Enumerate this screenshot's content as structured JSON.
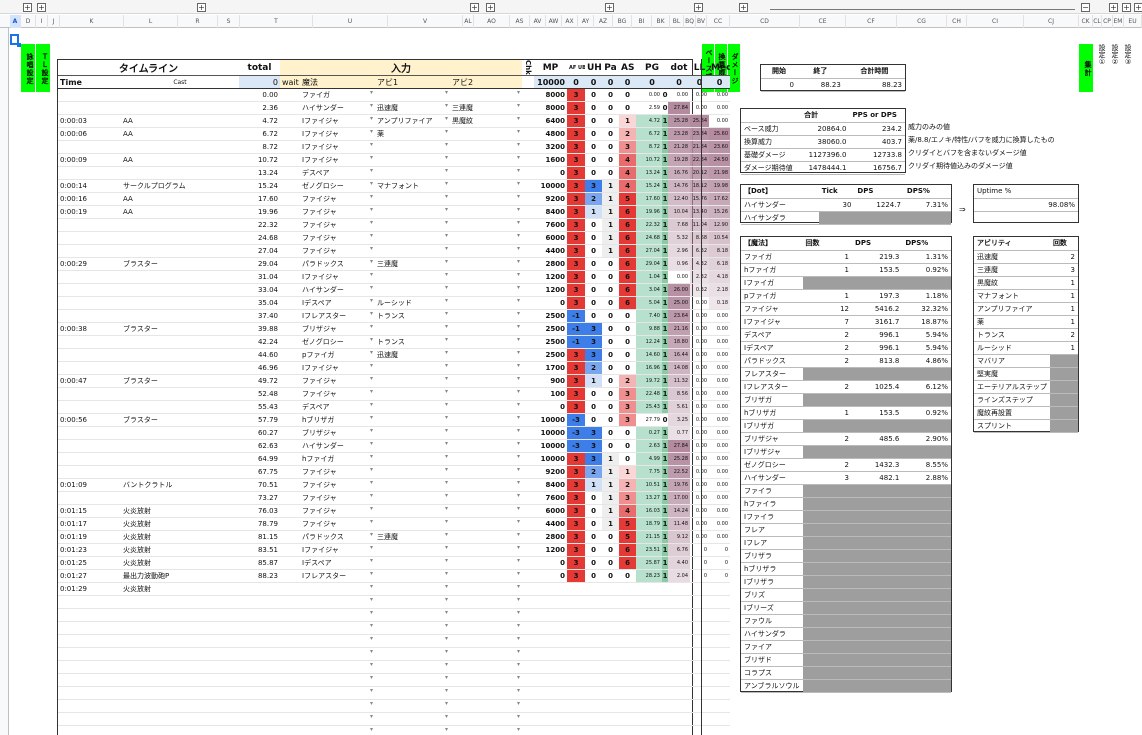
{
  "col_headers": [
    "A",
    "D",
    "I",
    "J",
    "K",
    "L",
    "R",
    "S",
    "T",
    "U",
    "V",
    "AL",
    "AO",
    "AS",
    "AV",
    "AW",
    "AX",
    "AY",
    "AZ",
    "BG",
    "BI",
    "BK",
    "BL",
    "BQ",
    "BV",
    "CC",
    "CD",
    "CE",
    "CF",
    "CG",
    "CH",
    "CI",
    "CJ",
    "CK",
    "CL",
    "CP",
    "EM",
    "EU"
  ],
  "side_labels": {
    "sozai": "詠唱設定",
    "tl": "ＴＬ設定",
    "base": "ベース威力",
    "kaisan": "換算威力",
    "dmg": "ダメージ",
    "shukei": "集計",
    "s1": "設定①",
    "s2": "設定②",
    "s3": "設定③"
  },
  "header": {
    "timeline": "タイムライン",
    "total": "total",
    "input": "入力",
    "chk": "Chk",
    "mp": "MP",
    "ahoo": "AF UB",
    "uh": "UH",
    "pa": "Pa",
    "as": "AS",
    "pg": "PG",
    "dot": "dot",
    "ll": "LL",
    "med": "Med",
    "time": "Time",
    "cast": "Cast",
    "total_val": "0",
    "wait": "wait",
    "skill": "魔法",
    "abi1": "アビ1",
    "abi2": "アビ2",
    "mp_val": "10000",
    "zeros": [
      "0",
      "0",
      "0",
      "0",
      "0",
      "0",
      "0",
      "0"
    ]
  },
  "rows": [
    {
      "t": "",
      "n": "",
      "tot": "0.00",
      "sk": "ファイガ",
      "a1": "",
      "a2": "",
      "mp": "8000",
      "af": "3",
      "uh": "0",
      "pa": "0",
      "as": "0",
      "pg": "0.00",
      "pgv": "0",
      "d": "0.00",
      "ll": "0.00",
      "md": "0.00"
    },
    {
      "t": "",
      "n": "",
      "tot": "2.36",
      "sk": "ハイサンダー",
      "a1": "迅速魔",
      "a2": "三連魔",
      "mp": "8000",
      "af": "3",
      "uh": "0",
      "pa": "0",
      "as": "0",
      "pg": "2.59",
      "pgv": "0",
      "d": "27.84",
      "ll": "0.00",
      "md": "0.00"
    },
    {
      "t": "0:00:03",
      "n": "AA",
      "tot": "4.72",
      "sk": "Iファイジャ",
      "a1": "アンプリファイア",
      "a2": "黒魔紋",
      "mp": "6400",
      "af": "3",
      "uh": "0",
      "pa": "0",
      "as": "1",
      "pg": "4.72",
      "pgv": "1",
      "d": "25.28",
      "ll": "25.84",
      "md": "0.00"
    },
    {
      "t": "0:00:06",
      "n": "AA",
      "tot": "6.72",
      "sk": "Iファイジャ",
      "a1": "薬",
      "a2": "",
      "mp": "4800",
      "af": "3",
      "uh": "0",
      "pa": "0",
      "as": "2",
      "pg": "6.72",
      "pgv": "1",
      "d": "23.28",
      "ll": "23.84",
      "md": "25.60"
    },
    {
      "t": "",
      "n": "",
      "tot": "8.72",
      "sk": "Iファイジャ",
      "a1": "",
      "a2": "",
      "mp": "3200",
      "af": "3",
      "uh": "0",
      "pa": "0",
      "as": "3",
      "pg": "8.72",
      "pgv": "1",
      "d": "21.28",
      "ll": "21.84",
      "md": "23.60"
    },
    {
      "t": "0:00:09",
      "n": "AA",
      "tot": "10.72",
      "sk": "Iファイジャ",
      "a1": "",
      "a2": "",
      "mp": "1600",
      "af": "3",
      "uh": "0",
      "pa": "0",
      "as": "4",
      "pg": "10.72",
      "pgv": "1",
      "d": "19.28",
      "ll": "22.84",
      "md": "24.50"
    },
    {
      "t": "",
      "n": "",
      "tot": "13.24",
      "sk": "デスペア",
      "a1": "",
      "a2": "",
      "mp": "0",
      "af": "3",
      "uh": "0",
      "pa": "0",
      "as": "4",
      "pg": "13.24",
      "pgv": "1",
      "d": "16.76",
      "ll": "20.12",
      "md": "21.98"
    },
    {
      "t": "0:00:14",
      "n": "サークルプログラム",
      "tot": "15.24",
      "sk": "ゼノグロシー",
      "a1": "マナフォント",
      "a2": "",
      "mp": "10000",
      "af": "3",
      "uh": "3",
      "pa": "1",
      "as": "4",
      "pg": "15.24",
      "pgv": "1",
      "d": "14.76",
      "ll": "18.12",
      "md": "19.98"
    },
    {
      "t": "0:00:16",
      "n": "AA",
      "tot": "17.60",
      "sk": "ファイジャ",
      "a1": "",
      "a2": "",
      "mp": "9200",
      "af": "3",
      "uh": "2",
      "pa": "1",
      "as": "5",
      "pg": "17.60",
      "pgv": "1",
      "d": "12.40",
      "ll": "15.76",
      "md": "17.62"
    },
    {
      "t": "0:00:19",
      "n": "AA",
      "tot": "19.96",
      "sk": "ファイジャ",
      "a1": "",
      "a2": "",
      "mp": "8400",
      "af": "3",
      "uh": "1",
      "pa": "1",
      "as": "6",
      "pg": "19.96",
      "pgv": "1",
      "d": "10.04",
      "ll": "13.40",
      "md": "15.26"
    },
    {
      "t": "",
      "n": "",
      "tot": "22.32",
      "sk": "ファイジャ",
      "a1": "",
      "a2": "",
      "mp": "7600",
      "af": "3",
      "uh": "0",
      "pa": "1",
      "as": "6",
      "pg": "22.32",
      "pgv": "1",
      "d": "7.68",
      "ll": "11.04",
      "md": "12.90"
    },
    {
      "t": "",
      "n": "",
      "tot": "24.68",
      "sk": "ファイジャ",
      "a1": "",
      "a2": "",
      "mp": "6000",
      "af": "3",
      "uh": "0",
      "pa": "1",
      "as": "6",
      "pg": "24.68",
      "pgv": "1",
      "d": "5.32",
      "ll": "8.68",
      "md": "10.54"
    },
    {
      "t": "",
      "n": "",
      "tot": "27.04",
      "sk": "ファイジャ",
      "a1": "",
      "a2": "",
      "mp": "4400",
      "af": "3",
      "uh": "0",
      "pa": "1",
      "as": "6",
      "pg": "27.04",
      "pgv": "1",
      "d": "2.96",
      "ll": "6.32",
      "md": "8.18"
    },
    {
      "t": "0:00:29",
      "n": "ブラスター",
      "tot": "29.04",
      "sk": "パラドックス",
      "a1": "三連魔",
      "a2": "",
      "mp": "2800",
      "af": "3",
      "uh": "0",
      "pa": "0",
      "as": "6",
      "pg": "29.04",
      "pgv": "1",
      "d": "0.96",
      "ll": "4.32",
      "md": "6.18"
    },
    {
      "t": "",
      "n": "",
      "tot": "31.04",
      "sk": "Iファイジャ",
      "a1": "",
      "a2": "",
      "mp": "1200",
      "af": "3",
      "uh": "0",
      "pa": "0",
      "as": "6",
      "pg": "1.04",
      "pgv": "1",
      "d": "0.00",
      "ll": "2.32",
      "md": "4.18"
    },
    {
      "t": "",
      "n": "",
      "tot": "33.04",
      "sk": "ハイサンダー",
      "a1": "",
      "a2": "",
      "mp": "1200",
      "af": "3",
      "uh": "0",
      "pa": "0",
      "as": "6",
      "pg": "3.04",
      "pgv": "1",
      "d": "26.00",
      "ll": "0.32",
      "md": "2.18"
    },
    {
      "t": "",
      "n": "",
      "tot": "35.04",
      "sk": "Iデスペア",
      "a1": "ルーシッド",
      "a2": "",
      "mp": "0",
      "af": "3",
      "uh": "0",
      "pa": "0",
      "as": "6",
      "pg": "5.04",
      "pgv": "1",
      "d": "25.00",
      "ll": "0.00",
      "md": "0.18"
    },
    {
      "t": "",
      "n": "",
      "tot": "37.40",
      "sk": "Iフレアスター",
      "a1": "トランス",
      "a2": "",
      "mp": "2500",
      "af": "-1",
      "uh": "0",
      "pa": "0",
      "as": "0",
      "pg": "7.40",
      "pgv": "1",
      "d": "23.64",
      "ll": "0.00",
      "md": "0.00"
    },
    {
      "t": "0:00:38",
      "n": "ブラスター",
      "tot": "39.88",
      "sk": "ブリザジャ",
      "a1": "",
      "a2": "",
      "mp": "2500",
      "af": "-1",
      "uh": "3",
      "pa": "0",
      "as": "0",
      "pg": "9.88",
      "pgv": "1",
      "d": "21.16",
      "ll": "0.00",
      "md": "0.00"
    },
    {
      "t": "",
      "n": "",
      "tot": "42.24",
      "sk": "ゼノグロシー",
      "a1": "トランス",
      "a2": "",
      "mp": "2500",
      "af": "-1",
      "uh": "3",
      "pa": "0",
      "as": "0",
      "pg": "12.24",
      "pgv": "1",
      "d": "18.80",
      "ll": "0.00",
      "md": "0.00"
    },
    {
      "t": "",
      "n": "",
      "tot": "44.60",
      "sk": "pファイガ",
      "a1": "迅速魔",
      "a2": "",
      "mp": "2500",
      "af": "3",
      "uh": "3",
      "pa": "0",
      "as": "0",
      "pg": "14.60",
      "pgv": "1",
      "d": "16.44",
      "ll": "0.00",
      "md": "0.00"
    },
    {
      "t": "",
      "n": "",
      "tot": "46.96",
      "sk": "Iファイジャ",
      "a1": "",
      "a2": "",
      "mp": "1700",
      "af": "3",
      "uh": "2",
      "pa": "0",
      "as": "0",
      "pg": "16.96",
      "pgv": "1",
      "d": "14.08",
      "ll": "0.00",
      "md": "0.00"
    },
    {
      "t": "0:00:47",
      "n": "ブラスター",
      "tot": "49.72",
      "sk": "ファイジャ",
      "a1": "",
      "a2": "",
      "mp": "900",
      "af": "3",
      "uh": "1",
      "pa": "0",
      "as": "2",
      "pg": "19.72",
      "pgv": "1",
      "d": "11.32",
      "ll": "0.00",
      "md": "0.00"
    },
    {
      "t": "",
      "n": "",
      "tot": "52.48",
      "sk": "ファイジャ",
      "a1": "",
      "a2": "",
      "mp": "100",
      "af": "3",
      "uh": "0",
      "pa": "0",
      "as": "3",
      "pg": "22.48",
      "pgv": "1",
      "d": "8.56",
      "ll": "0.00",
      "md": "0.00"
    },
    {
      "t": "",
      "n": "",
      "tot": "55.43",
      "sk": "デスペア",
      "a1": "",
      "a2": "",
      "mp": "0",
      "af": "3",
      "uh": "0",
      "pa": "0",
      "as": "3",
      "pg": "25.43",
      "pgv": "1",
      "d": "5.61",
      "ll": "0.00",
      "md": "0.00"
    },
    {
      "t": "0:00:56",
      "n": "ブラスター",
      "tot": "57.79",
      "sk": "hブリザガ",
      "a1": "",
      "a2": "",
      "mp": "10000",
      "af": "-3",
      "uh": "0",
      "pa": "0",
      "as": "3",
      "pg": "27.79",
      "pgv": "0",
      "d": "3.25",
      "ll": "0.00",
      "md": "0.00"
    },
    {
      "t": "",
      "n": "",
      "tot": "60.27",
      "sk": "ブリザジャ",
      "a1": "",
      "a2": "",
      "mp": "10000",
      "af": "-3",
      "uh": "3",
      "pa": "0",
      "as": "0",
      "pg": "0.27",
      "pgv": "1",
      "d": "0.77",
      "ll": "0.00",
      "md": "0.00"
    },
    {
      "t": "",
      "n": "",
      "tot": "62.63",
      "sk": "ハイサンダー",
      "a1": "",
      "a2": "",
      "mp": "10000",
      "af": "-3",
      "uh": "3",
      "pa": "0",
      "as": "0",
      "pg": "2.63",
      "pgv": "1",
      "d": "27.84",
      "ll": "0.00",
      "md": "0.00"
    },
    {
      "t": "",
      "n": "",
      "tot": "64.99",
      "sk": "hファイガ",
      "a1": "",
      "a2": "",
      "mp": "10000",
      "af": "3",
      "uh": "3",
      "pa": "1",
      "as": "0",
      "pg": "4.99",
      "pgv": "1",
      "d": "25.28",
      "ll": "0.00",
      "md": "0.00"
    },
    {
      "t": "",
      "n": "",
      "tot": "67.75",
      "sk": "ファイジャ",
      "a1": "",
      "a2": "",
      "mp": "9200",
      "af": "3",
      "uh": "2",
      "pa": "1",
      "as": "1",
      "pg": "7.75",
      "pgv": "1",
      "d": "22.52",
      "ll": "0.00",
      "md": "0.00"
    },
    {
      "t": "0:01:09",
      "n": "バントクラトル",
      "tot": "70.51",
      "sk": "ファイジャ",
      "a1": "",
      "a2": "",
      "mp": "8400",
      "af": "3",
      "uh": "1",
      "pa": "1",
      "as": "2",
      "pg": "10.51",
      "pgv": "1",
      "d": "19.76",
      "ll": "0.00",
      "md": "0.00"
    },
    {
      "t": "",
      "n": "",
      "tot": "73.27",
      "sk": "ファイジャ",
      "a1": "",
      "a2": "",
      "mp": "7600",
      "af": "3",
      "uh": "0",
      "pa": "1",
      "as": "3",
      "pg": "13.27",
      "pgv": "1",
      "d": "17.00",
      "ll": "0.00",
      "md": "0.00"
    },
    {
      "t": "0:01:15",
      "n": "火炎放射",
      "tot": "76.03",
      "sk": "ファイジャ",
      "a1": "",
      "a2": "",
      "mp": "6000",
      "af": "3",
      "uh": "0",
      "pa": "1",
      "as": "4",
      "pg": "16.03",
      "pgv": "1",
      "d": "14.24",
      "ll": "0.00",
      "md": "0.00"
    },
    {
      "t": "0:01:17",
      "n": "火炎放射",
      "tot": "78.79",
      "sk": "ファイジャ",
      "a1": "",
      "a2": "",
      "mp": "4400",
      "af": "3",
      "uh": "0",
      "pa": "1",
      "as": "5",
      "pg": "18.79",
      "pgv": "1",
      "d": "11.48",
      "ll": "0.00",
      "md": "0.00"
    },
    {
      "t": "0:01:19",
      "n": "火炎放射",
      "tot": "81.15",
      "sk": "パラドックス",
      "a1": "三連魔",
      "a2": "",
      "mp": "2800",
      "af": "3",
      "uh": "0",
      "pa": "0",
      "as": "5",
      "pg": "21.15",
      "pgv": "1",
      "d": "9.12",
      "ll": "0.00",
      "md": "0.00"
    },
    {
      "t": "0:01:23",
      "n": "火炎放射",
      "tot": "83.51",
      "sk": "Iファイジャ",
      "a1": "",
      "a2": "",
      "mp": "1200",
      "af": "3",
      "uh": "0",
      "pa": "0",
      "as": "6",
      "pg": "23.51",
      "pgv": "1",
      "d": "6.76",
      "ll": "0",
      "md": "0"
    },
    {
      "t": "0:01:25",
      "n": "火炎放射",
      "tot": "85.87",
      "sk": "Iデスペア",
      "a1": "",
      "a2": "",
      "mp": "0",
      "af": "3",
      "uh": "0",
      "pa": "0",
      "as": "6",
      "pg": "25.87",
      "pgv": "1",
      "d": "4.40",
      "ll": "0",
      "md": "0"
    },
    {
      "t": "0:01:27",
      "n": "最出力波動砲P",
      "tot": "88.23",
      "sk": "Iフレアスター",
      "a1": "",
      "a2": "",
      "mp": "0",
      "af": "3",
      "uh": "0",
      "pa": "0",
      "as": "0",
      "pg": "28.23",
      "pgv": "1",
      "d": "2.04",
      "ll": "0",
      "md": "0"
    },
    {
      "t": "0:01:29",
      "n": "火炎放射",
      "tot": "",
      "sk": "",
      "a1": "",
      "a2": "",
      "mp": "",
      "af": "",
      "uh": "",
      "pa": "",
      "as": "",
      "pg": "",
      "pgv": "",
      "d": "",
      "ll": "",
      "md": ""
    }
  ],
  "summary_top": {
    "h1": "開始",
    "h2": "終了",
    "h3": "合計時間",
    "v1": "0",
    "v2": "88.23",
    "v3": "88.23"
  },
  "power": {
    "h1": "合計",
    "h2": "PPS or DPS",
    "rows": [
      {
        "k": "ベース威力",
        "v": "20864.0",
        "p": "234.2",
        "note": "威力のみの値"
      },
      {
        "k": "換算威力",
        "v": "38060.0",
        "p": "403.7",
        "note": "薬/8.8/エノキ/特性/バフを威力に換算したもの"
      },
      {
        "k": "基礎ダメージ",
        "v": "1127396.0",
        "p": "12733.8",
        "note": "クリダイとバフを含まないダメージ値"
      },
      {
        "k": "ダメージ期待値",
        "v": "1478444.1",
        "p": "16756.7",
        "note": "クリダイ期待値込みのダメージ値"
      }
    ]
  },
  "dot": {
    "h0": "【Dot】",
    "h1": "Tick",
    "h2": "DPS",
    "h3": "DPS%",
    "rows": [
      {
        "k": "ハイサンダー",
        "v": "30",
        "p": "1224.7",
        "pct": "7.31%"
      },
      {
        "k": "ハイサンダラ",
        "v": "",
        "p": "",
        "pct": ""
      }
    ]
  },
  "uptime": {
    "h": "Uptime %",
    "v": "98.08%",
    "arrow": "⇒"
  },
  "magic": {
    "h0": "【魔法】",
    "h1": "回数",
    "h2": "DPS",
    "h3": "DPS%",
    "rows": [
      {
        "k": "ファイガ",
        "v": "1",
        "p": "219.3",
        "pct": "1.31%"
      },
      {
        "k": "hファイガ",
        "v": "1",
        "p": "153.5",
        "pct": "0.92%"
      },
      {
        "k": "Iファイガ",
        "v": "",
        "p": "",
        "pct": ""
      },
      {
        "k": "pファイガ",
        "v": "1",
        "p": "197.3",
        "pct": "1.18%"
      },
      {
        "k": "ファイジャ",
        "v": "12",
        "p": "5416.2",
        "pct": "32.32%"
      },
      {
        "k": "Iファイジャ",
        "v": "7",
        "p": "3161.7",
        "pct": "18.87%"
      },
      {
        "k": "デスペア",
        "v": "2",
        "p": "996.1",
        "pct": "5.94%"
      },
      {
        "k": "Iデスペア",
        "v": "2",
        "p": "996.1",
        "pct": "5.94%"
      },
      {
        "k": "パラドックス",
        "v": "2",
        "p": "813.8",
        "pct": "4.86%"
      },
      {
        "k": "フレアスター",
        "v": "",
        "p": "",
        "pct": ""
      },
      {
        "k": "Iフレアスター",
        "v": "2",
        "p": "1025.4",
        "pct": "6.12%"
      },
      {
        "k": "ブリザガ",
        "v": "",
        "p": "",
        "pct": ""
      },
      {
        "k": "hブリザガ",
        "v": "1",
        "p": "153.5",
        "pct": "0.92%"
      },
      {
        "k": "Iブリザガ",
        "v": "",
        "p": "",
        "pct": ""
      },
      {
        "k": "ブリザジャ",
        "v": "2",
        "p": "485.6",
        "pct": "2.90%"
      },
      {
        "k": "Iブリザジャ",
        "v": "",
        "p": "",
        "pct": ""
      },
      {
        "k": "ゼノグロシー",
        "v": "2",
        "p": "1432.3",
        "pct": "8.55%"
      },
      {
        "k": "ハイサンダー",
        "v": "3",
        "p": "482.1",
        "pct": "2.88%"
      },
      {
        "k": "ファイラ",
        "v": "",
        "p": "",
        "pct": ""
      },
      {
        "k": "hファイラ",
        "v": "",
        "p": "",
        "pct": ""
      },
      {
        "k": "Iファイラ",
        "v": "",
        "p": "",
        "pct": ""
      },
      {
        "k": "フレア",
        "v": "",
        "p": "",
        "pct": ""
      },
      {
        "k": "Iフレア",
        "v": "",
        "p": "",
        "pct": ""
      },
      {
        "k": "ブリザラ",
        "v": "",
        "p": "",
        "pct": ""
      },
      {
        "k": "hブリザラ",
        "v": "",
        "p": "",
        "pct": ""
      },
      {
        "k": "Iブリザラ",
        "v": "",
        "p": "",
        "pct": ""
      },
      {
        "k": "ブリズ",
        "v": "",
        "p": "",
        "pct": ""
      },
      {
        "k": "Iブリーズ",
        "v": "",
        "p": "",
        "pct": ""
      },
      {
        "k": "ファウル",
        "v": "",
        "p": "",
        "pct": ""
      },
      {
        "k": "ハイサンダラ",
        "v": "",
        "p": "",
        "pct": ""
      },
      {
        "k": "ファイア",
        "v": "",
        "p": "",
        "pct": ""
      },
      {
        "k": "ブリザド",
        "v": "",
        "p": "",
        "pct": ""
      },
      {
        "k": "コラプス",
        "v": "",
        "p": "",
        "pct": ""
      },
      {
        "k": "アンブラルソウル",
        "v": "",
        "p": "",
        "pct": ""
      }
    ]
  },
  "ability": {
    "h1": "アビリティ",
    "h2": "回数",
    "rows": [
      {
        "k": "迅速魔",
        "v": "2"
      },
      {
        "k": "三連魔",
        "v": "3"
      },
      {
        "k": "黒魔紋",
        "v": "1"
      },
      {
        "k": "マナフォント",
        "v": "1"
      },
      {
        "k": "アンプリファイア",
        "v": "1"
      },
      {
        "k": "薬",
        "v": "1"
      },
      {
        "k": "トランス",
        "v": "2"
      },
      {
        "k": "ルーシッド",
        "v": "1"
      },
      {
        "k": "マバリア",
        "v": ""
      },
      {
        "k": "堅実魔",
        "v": ""
      },
      {
        "k": "エーテリアルステップ",
        "v": ""
      },
      {
        "k": "ラインズステップ",
        "v": ""
      },
      {
        "k": "魔紋再設置",
        "v": ""
      },
      {
        "k": "スプリント",
        "v": ""
      }
    ]
  },
  "colors": {
    "red": "#e53935",
    "blue": "#3d7ee8",
    "green": "#00ff00",
    "gray": "#9e9e9e",
    "pink": "#f4b6c2",
    "lightblue": "#cfe0f7",
    "teal": "#b7e1cd",
    "mauve": "#b38a9e"
  }
}
